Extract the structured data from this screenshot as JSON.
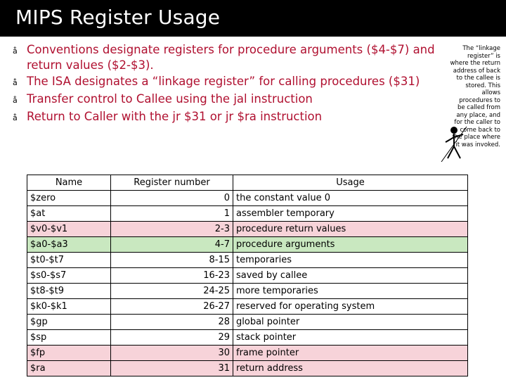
{
  "slide": {
    "title": "MIPS Register Usage",
    "bullet_mark": "å",
    "bullets": [
      "Conventions designate registers for procedure arguments ($4-$7) and return values ($2-$3).",
      "The ISA designates a “linkage register” for calling procedures ($31)",
      "Transfer control to Callee using the jal instruction",
      "Return to Caller with the jr $31 or jr $ra instruction"
    ],
    "side_note": "The “linkage register” is where the return address of back to the callee is stored. This allows procedures to be called from any place, and for the caller to come back to the place where it was invoked."
  },
  "table": {
    "headers": [
      "Name",
      "Register number",
      "Usage"
    ],
    "rows": [
      {
        "name": "$zero",
        "number": "0",
        "usage": "the constant value 0",
        "tint": "none"
      },
      {
        "name": "$at",
        "number": "1",
        "usage": "assembler temporary",
        "tint": "none"
      },
      {
        "name": "$v0-$v1",
        "number": "2-3",
        "usage": "procedure return values",
        "tint": "pink"
      },
      {
        "name": "$a0-$a3",
        "number": "4-7",
        "usage": "procedure arguments",
        "tint": "green"
      },
      {
        "name": "$t0-$t7",
        "number": "8-15",
        "usage": "temporaries",
        "tint": "none"
      },
      {
        "name": "$s0-$s7",
        "number": "16-23",
        "usage": "saved by callee",
        "tint": "none"
      },
      {
        "name": "$t8-$t9",
        "number": "24-25",
        "usage": "more temporaries",
        "tint": "none"
      },
      {
        "name": "$k0-$k1",
        "number": "26-27",
        "usage": "reserved for operating system",
        "tint": "none"
      },
      {
        "name": "$gp",
        "number": "28",
        "usage": "global pointer",
        "tint": "none"
      },
      {
        "name": "$sp",
        "number": "29",
        "usage": "stack pointer",
        "tint": "none"
      },
      {
        "name": "$fp",
        "number": "30",
        "usage": "frame pointer",
        "tint": "pink"
      },
      {
        "name": "$ra",
        "number": "31",
        "usage": "return address",
        "tint": "pink"
      }
    ]
  },
  "colors": {
    "title_bar": "#000000",
    "title_text": "#ffffff",
    "bullet_text": "#b01030",
    "row_tint_pink": "#f7d3d9",
    "row_tint_green": "#c9e8c0"
  }
}
